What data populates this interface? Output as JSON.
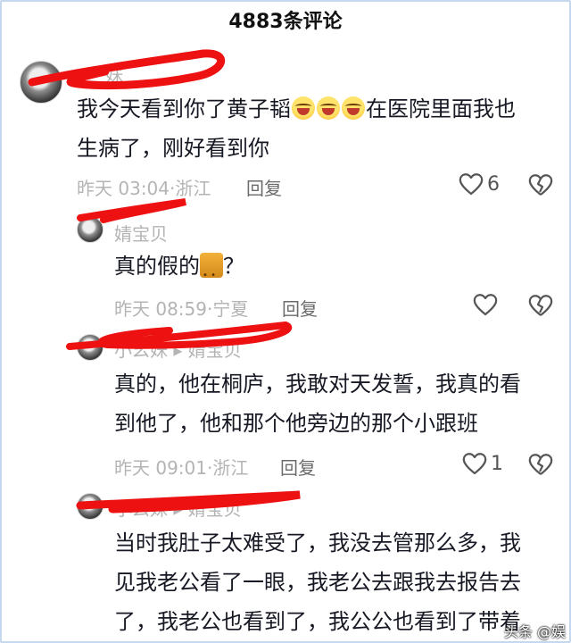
{
  "header": {
    "title": "4883条评论"
  },
  "comments": [
    {
      "name": "妹",
      "lines": [
        "我今天看到你了黄子韬",
        "在医院里面我也",
        "生病了，刚好看到你"
      ],
      "meta": "昨天 03:04·浙江",
      "reply_label": "回复",
      "likes": "6"
    },
    {
      "name": "婧宝贝",
      "lines": [
        "真的假的",
        "？"
      ],
      "meta": "昨天 08:59·宁夏",
      "reply_label": "回复",
      "likes": ""
    },
    {
      "name": "小幺妹 ▸ 婧宝贝",
      "lines": [
        "真的，他在桐庐，我敢对天发誓，我真的看",
        "到他了，他和那个他旁边的那个小跟班"
      ],
      "meta": "昨天 09:01·浙江",
      "reply_label": "回复",
      "likes": "1"
    },
    {
      "name": "小幺妹 ▸ 婧宝贝",
      "lines": [
        "当时我肚子太难受了，我没去管那么多，我",
        "见我老公看了一眼，我老公去跟我去报告去",
        "了，我老公也看到了，我公公也看到了带着"
      ]
    }
  ],
  "watermark": "头条 @娱"
}
